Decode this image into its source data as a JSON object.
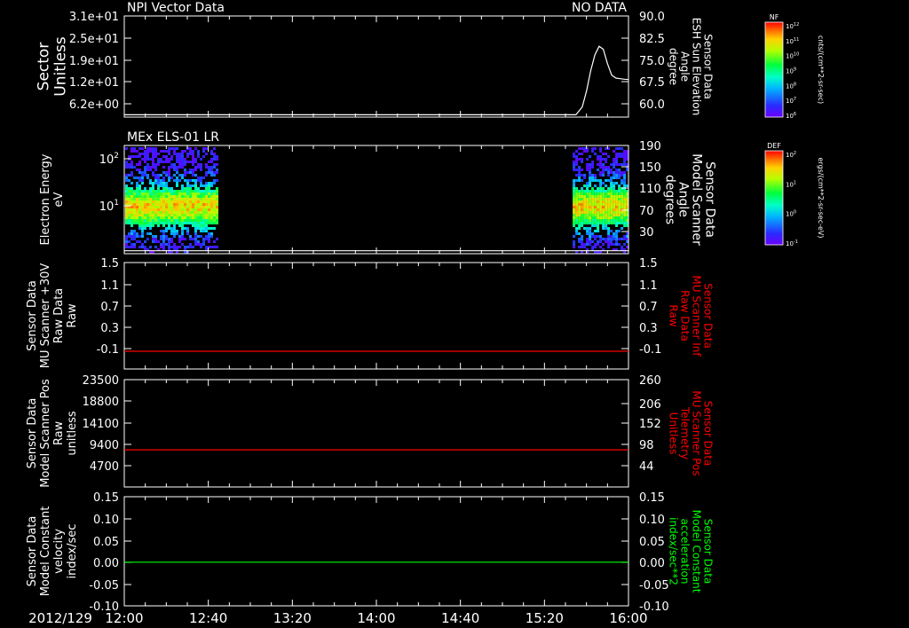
{
  "time_axis": {
    "date_label": "2012/129",
    "ticks": [
      "12:00",
      "12:40",
      "13:20",
      "14:00",
      "14:40",
      "15:20",
      "16:00"
    ],
    "range_minutes": [
      0,
      240
    ]
  },
  "colorbars": [
    {
      "tag": "NF",
      "units": "cnts/(cm**2-sr-sec)",
      "tick_labels": [
        "10^12",
        "10^11",
        "10^10",
        "10^9",
        "10^8",
        "10^7",
        "10^6"
      ]
    },
    {
      "tag": "DEF",
      "units": "ergs/(cm**2-sr-sec-eV)",
      "tick_labels": [
        "10^2",
        "10^1",
        "10^0",
        "10^-1"
      ]
    }
  ],
  "chart_data": [
    {
      "type": "line",
      "title": "NPI Vector Data",
      "status": "NO DATA",
      "ylabel_lines": [
        "Sector",
        "Unitless"
      ],
      "ylabel_color": "#ffffff",
      "yticks": [
        "3.1e+01",
        "2.5e+01",
        "1.9e+01",
        "1.2e+01",
        "6.2e+00"
      ],
      "ylim": [
        0,
        31
      ],
      "y2label_lines": [
        "Sensor Data",
        "ESH Sun Elevation",
        "Angle",
        "degree"
      ],
      "y2label_color": "#ffffff",
      "y2ticks": [
        "90.0",
        "82.5",
        "75.0",
        "67.5",
        "60.0"
      ],
      "y2lim": [
        55,
        90
      ],
      "series": [
        {
          "color": "#ffffff",
          "axis": "right",
          "x": [
            0,
            215,
            218,
            220,
            222,
            224,
            226,
            228,
            230,
            232,
            234,
            236,
            238,
            240
          ],
          "y": [
            55.8,
            55.8,
            58.5,
            64,
            71,
            76.5,
            79.5,
            78.5,
            73.5,
            69.5,
            68.5,
            68.3,
            68.1,
            68
          ]
        }
      ]
    },
    {
      "type": "heatmap",
      "title": "MEx ELS-01 LR",
      "ylabel_lines": [
        "Electron Energy",
        "eV"
      ],
      "ylabel_color": "#ffffff",
      "yticks": [
        "10^2",
        "10^1"
      ],
      "y_scale": "log",
      "ylim": [
        1.5,
        160
      ],
      "y2label_lines": [
        "Sensor Data",
        "Model Scanner",
        "Angle",
        "degrees"
      ],
      "y2label_color": "#ffffff",
      "y2ticks": [
        "190",
        "150",
        "110",
        "70",
        "30"
      ],
      "y2lim": [
        5,
        190
      ],
      "data_intervals_minutes": [
        [
          0,
          45
        ],
        [
          213,
          240
        ]
      ],
      "core_energy_eV": 12,
      "series": [
        {
          "color": "#ffffff",
          "axis": "right",
          "x": [
            0,
            240
          ],
          "y": [
            10,
            10
          ]
        }
      ]
    },
    {
      "type": "line",
      "ylabel_lines": [
        "Sensor Data",
        "MU Scanner +30V",
        "Raw Data",
        "Raw"
      ],
      "ylabel_color": "#ffffff",
      "yticks": [
        "1.5",
        "1.1",
        "0.7",
        "0.3",
        "-0.1"
      ],
      "ylim": [
        -0.3,
        1.5
      ],
      "y2label_lines": [
        "Sensor Data",
        "MU Scanner Inf",
        "Raw Data",
        "Raw"
      ],
      "y2label_color": "#ff0000",
      "y2ticks": [
        "1.5",
        "1.1",
        "0.7",
        "0.3",
        "-0.1"
      ],
      "y2lim": [
        -0.3,
        1.5
      ],
      "series": [
        {
          "color": "#ff0000",
          "axis": "right",
          "x": [
            0,
            240
          ],
          "y": [
            0.0,
            0.0
          ]
        }
      ]
    },
    {
      "type": "line",
      "ylabel_lines": [
        "Sensor Data",
        "Model Scanner Pos",
        "Raw",
        "unitless"
      ],
      "ylabel_color": "#ffffff",
      "yticks": [
        "23500",
        "18800",
        "14100",
        "9400",
        "4700"
      ],
      "ylim": [
        0,
        23500
      ],
      "y2label_lines": [
        "Sensor Data",
        "MU Scanner Pos",
        "Telemetry",
        "Unitless"
      ],
      "y2label_color": "#ff0000",
      "y2ticks": [
        "260",
        "206",
        "152",
        "98",
        "44"
      ],
      "y2lim": [
        0,
        260
      ],
      "series": [
        {
          "color": "#ff0000",
          "axis": "right",
          "x": [
            0,
            240
          ],
          "y": [
            90,
            90
          ]
        }
      ]
    },
    {
      "type": "line",
      "ylabel_lines": [
        "Sensor Data",
        "Model Constant",
        "velocity",
        "index/sec"
      ],
      "ylabel_color": "#ffffff",
      "yticks": [
        "0.15",
        "0.10",
        "0.05",
        "0.00",
        "-0.05",
        "-0.10"
      ],
      "ylim": [
        -0.1,
        0.15
      ],
      "y2label_lines": [
        "Sensor Data",
        "Model Constant",
        "acceleration",
        "index/sec**2"
      ],
      "y2label_color": "#00ff00",
      "y2ticks": [
        "0.15",
        "0.10",
        "0.05",
        "0.00",
        "-0.05",
        "-0.10"
      ],
      "y2lim": [
        -0.1,
        0.15
      ],
      "series": [
        {
          "color": "#00ff00",
          "axis": "left",
          "x": [
            0,
            240
          ],
          "y": [
            0.0,
            0.0
          ]
        }
      ]
    }
  ]
}
